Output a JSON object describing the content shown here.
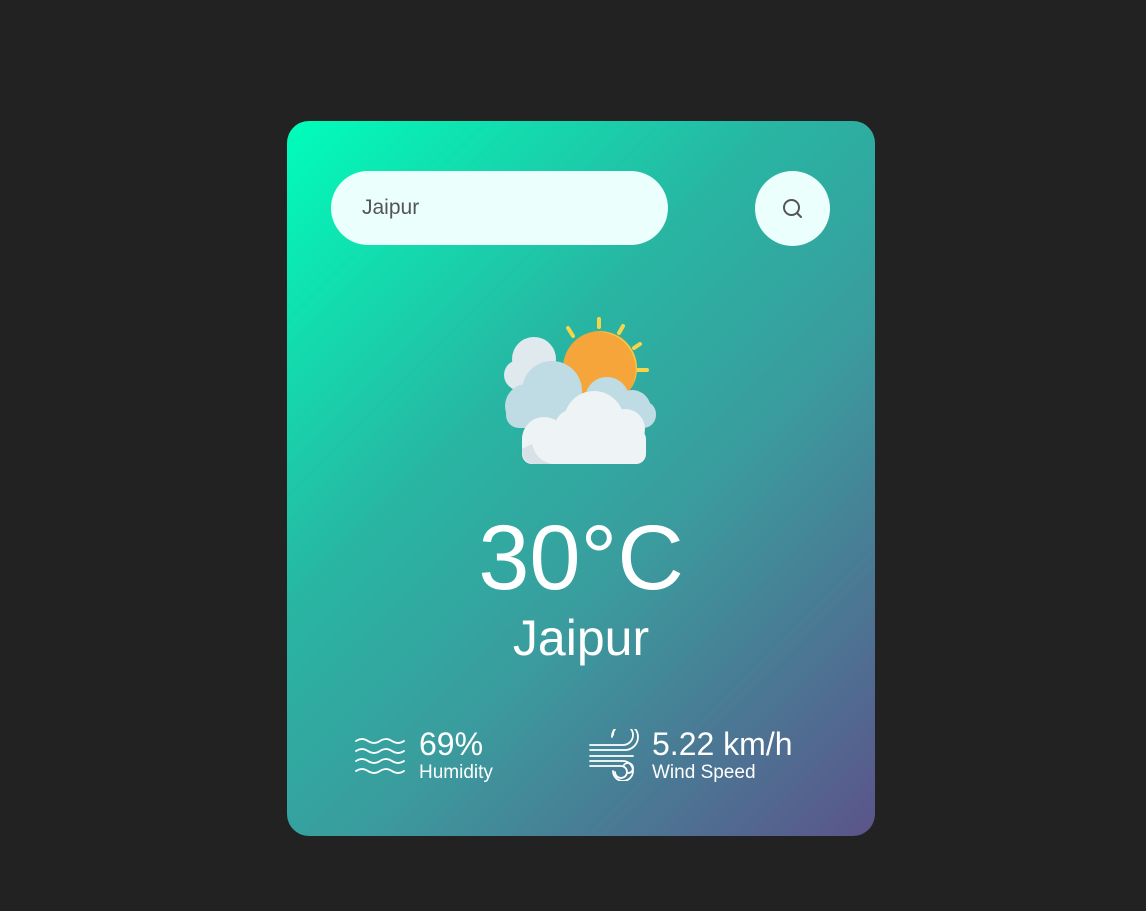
{
  "search": {
    "value": "Jaipur",
    "placeholder": ""
  },
  "search_button": {
    "icon": "search-icon"
  },
  "weather": {
    "icon": "partly-cloudy-icon",
    "temperature": "30°C",
    "city": "Jaipur"
  },
  "humidity": {
    "icon": "humidity-icon",
    "value": "69%",
    "label": "Humidity"
  },
  "wind": {
    "icon": "wind-icon",
    "value": "5.22 km/h",
    "label": "Wind Speed"
  },
  "colors": {
    "background": "#222222",
    "card_gradient_start": "#00feba",
    "card_gradient_end": "#5b548a",
    "input_background": "#ebfffc",
    "text": "#ffffff"
  }
}
